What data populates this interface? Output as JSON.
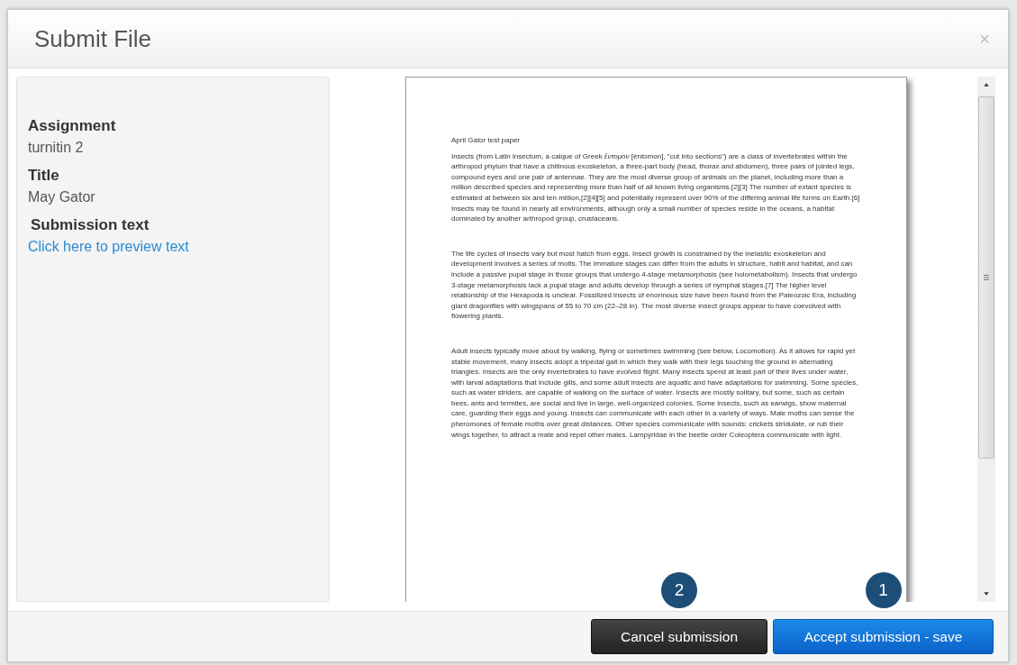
{
  "dialog": {
    "title": "Submit File",
    "close": "×"
  },
  "details": [
    {
      "label": "Assignment",
      "value": "turnitin 2",
      "kind": "text"
    },
    {
      "label": "Title",
      "value": "May Gator",
      "kind": "text"
    },
    {
      "label": "Submission text",
      "value": "Click here to preview text",
      "kind": "link"
    }
  ],
  "document": {
    "heading": "April Gator test paper",
    "paragraphs": [
      "Insects (from Latin insectum, a calque of Greek *ἔντομον* [éntomon], \"cut into sections\") are a class of invertebrates within the arthropod phylum that have a chitinous exoskeleton, a three-part body (head, thorax and abdomen), three pairs of jointed legs, compound eyes and one pair of antennae. They are the most diverse group of animals on the planet, including more than a million described species and representing more than half of all known living organisms.[2][3] The number of extant species is estimated at between six and ten million,[2][4][5] and potentially represent over 90% of the differing animal life forms on Earth.[6] Insects may be found in nearly all environments, although only a small number of species reside in the oceans, a habitat dominated by another arthropod group, crustaceans.",
      "The life cycles of insects vary but most hatch from eggs. Insect growth is constrained by the inelastic exoskeleton and development involves a series of molts. The immature stages can differ from the adults in structure, habit and habitat, and can include a passive pupal stage in those groups that undergo 4-stage metamorphosis (see holometabolism). Insects that undergo 3-stage metamorphosis lack a pupal stage and adults develop through a series of nymphal stages.[7] The higher level relationship of the Hexapoda is unclear. Fossilized insects of enormous size have been found from the Paleozoic Era, including giant dragonflies with wingspans of 55 to 70 cm (22–28 in). The most diverse insect groups appear to have coevolved with flowering plants.",
      "Adult insects typically move about by walking, flying or sometimes swimming (see below, Locomotion). As it allows for rapid yet stable movement, many insects adopt a tripedal gait in which they walk with their legs touching the ground in alternating triangles. Insects are the only invertebrates to have evolved flight. Many insects spend at least part of their lives under water, with larval adaptations that include gills, and some adult insects are aquatic and have adaptations for swimming. Some species, such as water striders, are capable of walking on the surface of water. Insects are mostly solitary, but some, such as certain bees, ants and termites, are social and live in large, well-organized colonies. Some insects, such as earwigs, show maternal care, guarding their eggs and young. Insects can communicate with each other in a variety of ways. Male moths can sense the pheromones of female moths over great distances. Other species communicate with sounds: crickets stridulate, or rub their wings together, to attract a mate and repel other males. Lampyridae in the beetle order Coleoptera communicate with light."
    ]
  },
  "buttons": [
    {
      "label": "Cancel submission",
      "kind": "secondary",
      "badge": "2"
    },
    {
      "label": "Accept submission - save",
      "kind": "primary",
      "badge": "1"
    }
  ]
}
